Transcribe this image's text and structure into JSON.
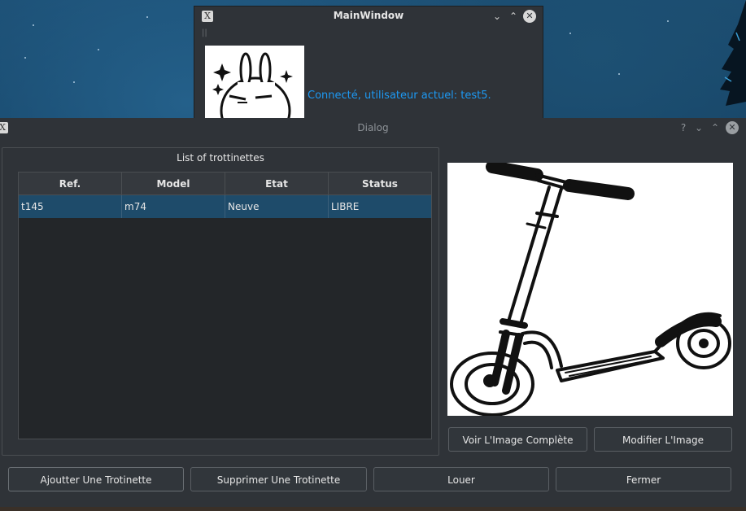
{
  "main_window": {
    "title": "MainWindow",
    "status": "Connecté, utilisateur actuel: test5."
  },
  "dialog": {
    "title": "Dialog",
    "group_title": "List of trottinettes",
    "table": {
      "headers": [
        "Ref.",
        "Model",
        "Etat",
        "Status"
      ],
      "rows": [
        [
          "t145",
          "m74",
          "Neuve",
          "LIBRE"
        ]
      ]
    },
    "image_buttons": {
      "view_full": "Voir L'Image Complète",
      "modify": "Modifier L'Image"
    },
    "actions": {
      "add": "Ajoutter Une Trotinette",
      "delete": "Supprimer Une Trotinette",
      "rent": "Louer",
      "close": "Fermer"
    }
  },
  "icons": {
    "app": "x-app-icon",
    "minimize": "chevron-down-icon",
    "maximize": "chevron-up-icon",
    "close": "close-icon",
    "help": "help-icon"
  },
  "colors": {
    "accent": "#1d99f3",
    "window_bg": "#2f3338",
    "table_bg": "#232629",
    "selection": "#1e4b6a"
  }
}
